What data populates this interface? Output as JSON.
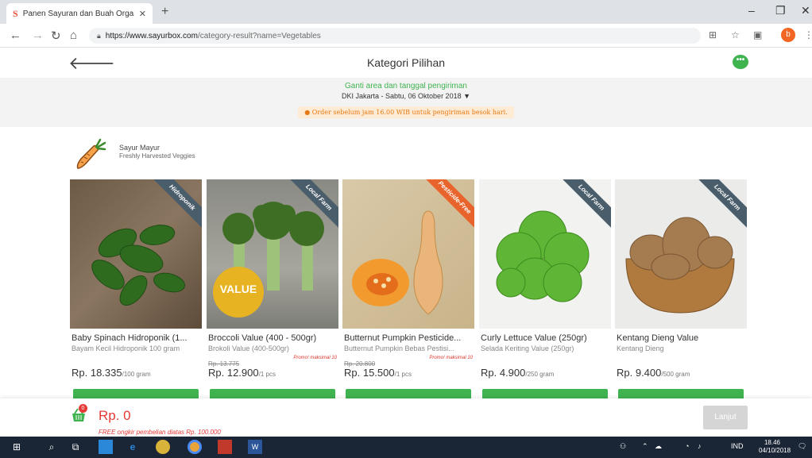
{
  "browser": {
    "tab_title": "Panen Sayuran dan Buah Organik",
    "tab_favicon": "S",
    "url_host": "https://www.sayurbox.com",
    "url_path": "/category-result?name=Vegetables",
    "profile_initial": "b"
  },
  "header": {
    "title": "Kategori Pilihan"
  },
  "delivery": {
    "change_link": "Ganti area dan tanggal pengiriman",
    "info": "DKI Jakarta - Sabtu, 06 Oktober 2018 ▼",
    "notice": "● Order sebelum jam 16.00 WIB untuk pengiriman besok hari."
  },
  "category": {
    "name": "Sayur Mayur",
    "subtitle": "Freshly Harvested Veggies"
  },
  "products": [
    {
      "name": "Baby Spinach Hidroponik (1...",
      "sub": "Bayam Kecil Hidroponik 100 gram",
      "old_price": "",
      "promo": "",
      "price": "Rp. 18.335",
      "unit": "/100 gram",
      "ribbon": "Hidroponik",
      "ribbon_color": "#4a5d6b"
    },
    {
      "name": "Broccoli Value (400 - 500gr)",
      "sub": "Brokoli Value (400-500gr)",
      "old_price": "Rp. 13.775",
      "promo": "Promo! maksimal 10",
      "price": "Rp. 12.900",
      "unit": "/1 pcs",
      "ribbon": "Local Farm",
      "ribbon_color": "#4a5d6b",
      "value_badge": "VALUE"
    },
    {
      "name": "Butternut Pumpkin Pesticide...",
      "sub": "Butternut Pumpkin Bebas Pestisi...",
      "old_price": "Rp. 20.800",
      "promo": "Promo! maksimal 10",
      "price": "Rp. 15.500",
      "unit": "/1 pcs",
      "ribbon": "Pesticide-Free",
      "ribbon_color": "#e8642c"
    },
    {
      "name": "Curly Lettuce Value (250gr)",
      "sub": "Selada Keriting Value (250gr)",
      "old_price": "",
      "promo": "",
      "price": "Rp. 4.900",
      "unit": "/250 gram",
      "ribbon": "Local Farm",
      "ribbon_color": "#4a5d6b"
    },
    {
      "name": "Kentang Dieng Value",
      "sub": "Kentang Dieng",
      "old_price": "",
      "promo": "",
      "price": "Rp. 9.400",
      "unit": "/500 gram",
      "ribbon": "Local Farm",
      "ribbon_color": "#4a5d6b"
    }
  ],
  "cart": {
    "badge": "0",
    "total": "Rp. 0",
    "free_shipping": "FREE ongkir pembelian diatas Rp. 100.000",
    "checkout_label": "Lanjut"
  },
  "taskbar": {
    "lang": "IND",
    "time": "18.46",
    "date": "04/10/2018"
  },
  "colors": {
    "accent_green": "#3fb34f",
    "price_red": "#e53935",
    "notice_orange": "#e57a14"
  }
}
